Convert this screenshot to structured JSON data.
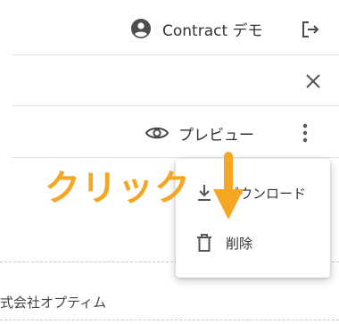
{
  "header": {
    "user_icon": "account-circle-icon",
    "user_name": "Contract デモ",
    "logout_icon": "logout-icon"
  },
  "toolbar": {
    "close_icon": "close-icon",
    "preview_icon": "eye-icon",
    "preview_label": "プレビュー",
    "more_icon": "more-vertical-icon"
  },
  "menu": {
    "items": [
      {
        "icon": "download-icon",
        "label": "ダウンロード"
      },
      {
        "icon": "trash-icon",
        "label": "削除"
      }
    ]
  },
  "document": {
    "company_name": "式会社オプティム"
  },
  "annotation": {
    "text": "クリック",
    "color": "#f5a623"
  }
}
